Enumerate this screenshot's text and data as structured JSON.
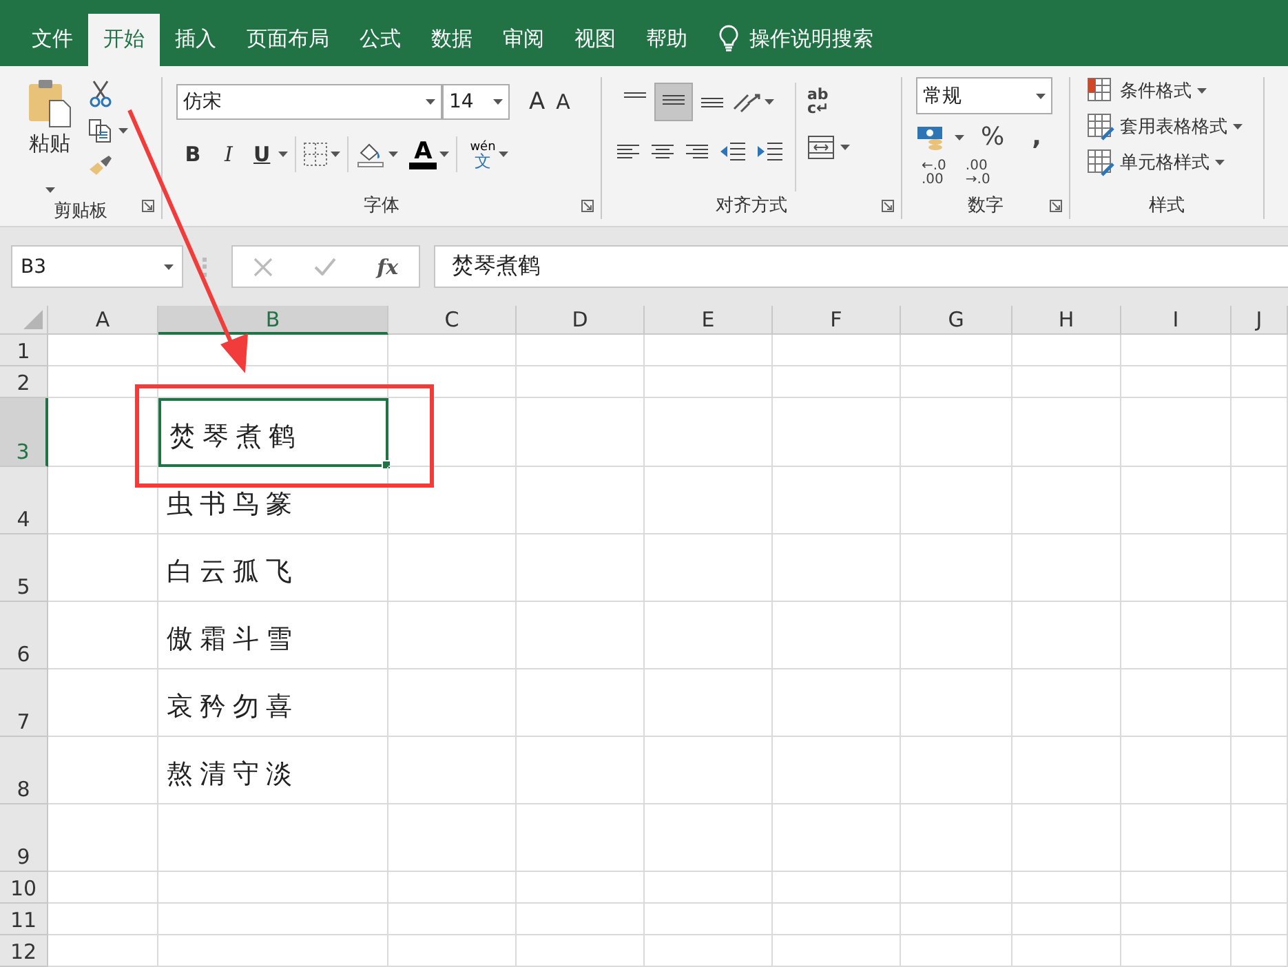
{
  "tabs": [
    {
      "label": "文件",
      "selected": false
    },
    {
      "label": "开始",
      "selected": true
    },
    {
      "label": "插入",
      "selected": false
    },
    {
      "label": "页面布局",
      "selected": false
    },
    {
      "label": "公式",
      "selected": false
    },
    {
      "label": "数据",
      "selected": false
    },
    {
      "label": "审阅",
      "selected": false
    },
    {
      "label": "视图",
      "selected": false
    },
    {
      "label": "帮助",
      "selected": false
    }
  ],
  "tell_me": "操作说明搜索",
  "clipboard": {
    "paste": "粘贴",
    "label": "剪贴板"
  },
  "font": {
    "name": "仿宋",
    "size": "14",
    "grow": "A",
    "shrink": "A",
    "bold": "B",
    "italic": "I",
    "underline": "U",
    "color_letter": "A",
    "phonetic_top": "wén",
    "phonetic_bottom": "文",
    "label": "字体"
  },
  "alignment": {
    "top_align_pressed": false,
    "middle_align_pressed": true,
    "bottom_align_pressed": false,
    "wrap_top": "ab",
    "wrap_bottom": "c↵",
    "label": "对齐方式"
  },
  "number": {
    "format": "常规",
    "percent": "%",
    "comma": ",",
    "increase_decimal": [
      "←.0",
      ".00"
    ],
    "decrease_decimal": [
      ".00",
      "→.0"
    ],
    "label": "数字"
  },
  "styles": {
    "items": [
      "条件格式",
      "套用表格格式",
      "单元格样式"
    ],
    "label": "样式"
  },
  "name_box": "B3",
  "fx": "fx",
  "formula": "焚琴煮鹤",
  "columns": [
    {
      "label": "A",
      "selected": false
    },
    {
      "label": "B",
      "selected": true
    },
    {
      "label": "C",
      "selected": false
    },
    {
      "label": "D",
      "selected": false
    },
    {
      "label": "E",
      "selected": false
    },
    {
      "label": "F",
      "selected": false
    },
    {
      "label": "G",
      "selected": false
    },
    {
      "label": "H",
      "selected": false
    },
    {
      "label": "I",
      "selected": false
    },
    {
      "label": "J",
      "selected": false
    }
  ],
  "rows": [
    {
      "header": "1",
      "selected": false,
      "b": ""
    },
    {
      "header": "2",
      "selected": false,
      "b": ""
    },
    {
      "header": "3",
      "selected": true,
      "b": "焚琴煮鹤"
    },
    {
      "header": "4",
      "selected": false,
      "b": "虫书鸟篆"
    },
    {
      "header": "5",
      "selected": false,
      "b": "白云孤飞"
    },
    {
      "header": "6",
      "selected": false,
      "b": "傲霜斗雪"
    },
    {
      "header": "7",
      "selected": false,
      "b": "哀矜勿喜"
    },
    {
      "header": "8",
      "selected": false,
      "b": "熬清守淡"
    },
    {
      "header": "9",
      "selected": false,
      "b": ""
    },
    {
      "header": "10",
      "selected": false,
      "b": ""
    },
    {
      "header": "11",
      "selected": false,
      "b": ""
    },
    {
      "header": "12",
      "selected": false,
      "b": ""
    }
  ]
}
